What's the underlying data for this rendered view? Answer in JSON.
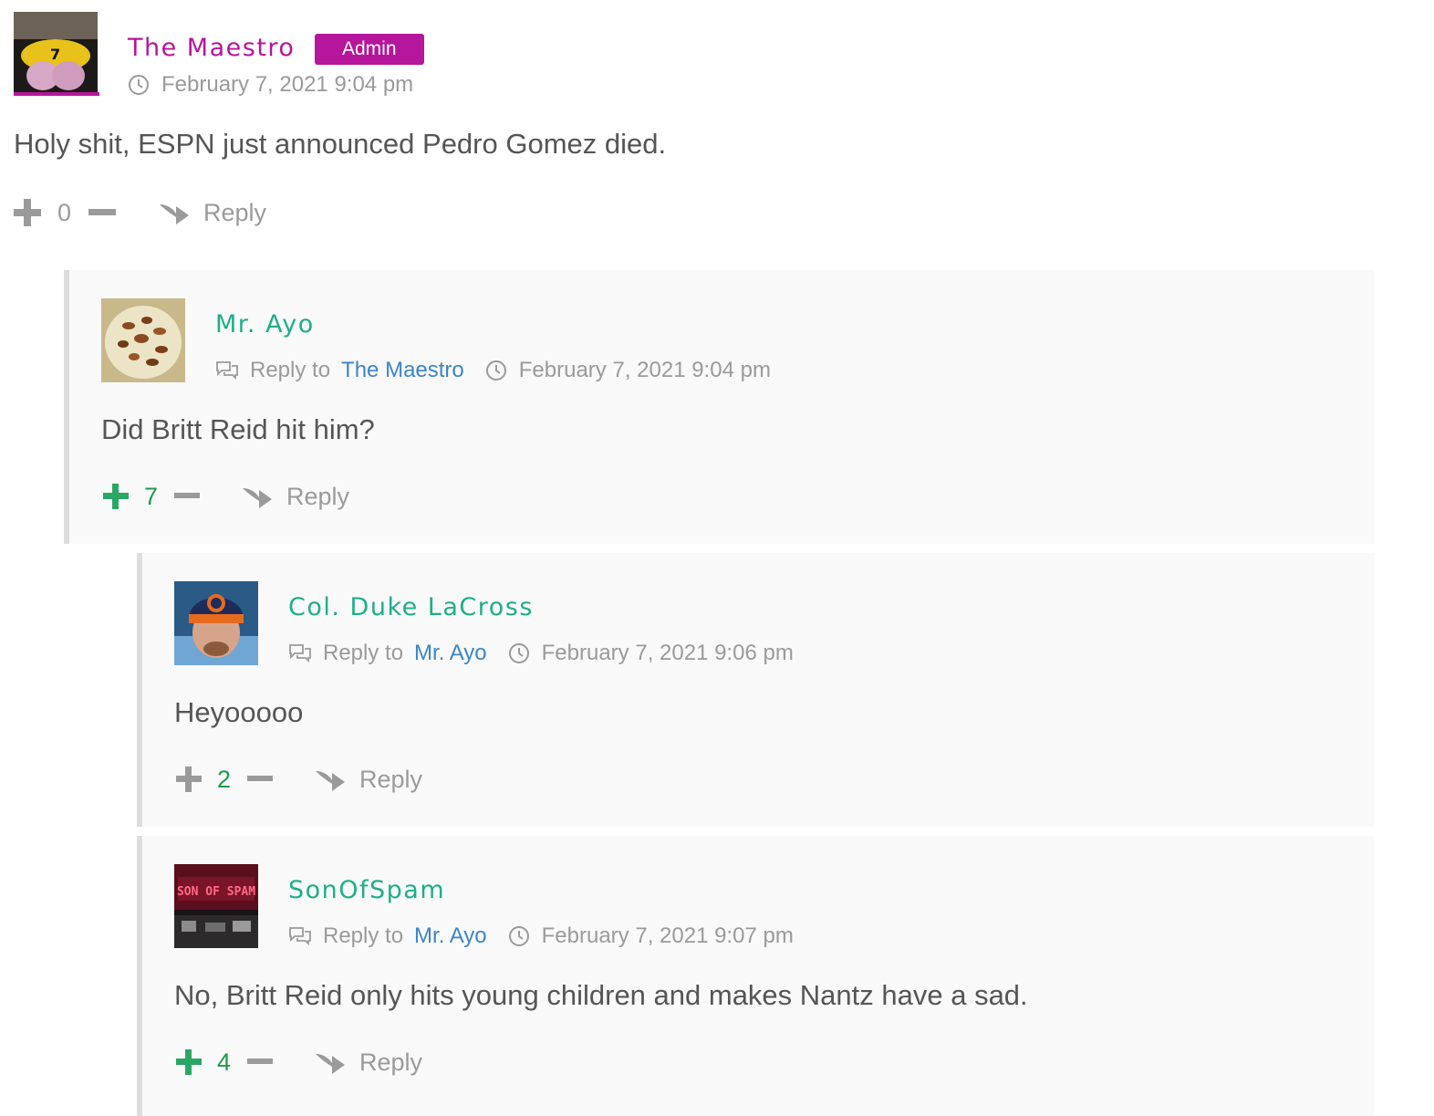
{
  "comments": [
    {
      "author": "The Maestro",
      "badge": "Admin",
      "date": "February 7, 2021 9:04 pm",
      "text": "Holy shit, ESPN just announced Pedro Gomez died.",
      "votes": "0",
      "reply_label": "Reply"
    },
    {
      "author": "Mr. Ayo",
      "reply_to_label": "Reply to",
      "reply_to_name": "The Maestro",
      "date": "February 7, 2021 9:04 pm",
      "text": "Did Britt Reid hit him?",
      "votes": "7",
      "reply_label": "Reply"
    },
    {
      "author": "Col. Duke LaCross",
      "reply_to_label": "Reply to",
      "reply_to_name": "Mr. Ayo",
      "date": "February 7, 2021 9:06 pm",
      "text": "Heyooooo",
      "votes": "2",
      "reply_label": "Reply"
    },
    {
      "author": "SonOfSpam",
      "reply_to_label": "Reply to",
      "reply_to_name": "Mr. Ayo",
      "date": "February 7, 2021 9:07 pm",
      "text": "No, Britt Reid only hits young children and makes Nantz have a sad.",
      "votes": "4",
      "reply_label": "Reply"
    }
  ],
  "avatar_logo_text": "SON OF SPAM",
  "colors": {
    "admin": "#b5169b",
    "guest_author": "#1fae87",
    "link": "#3b86c6",
    "positive_vote": "#1f9a4a",
    "muted": "#9a9a9a"
  }
}
